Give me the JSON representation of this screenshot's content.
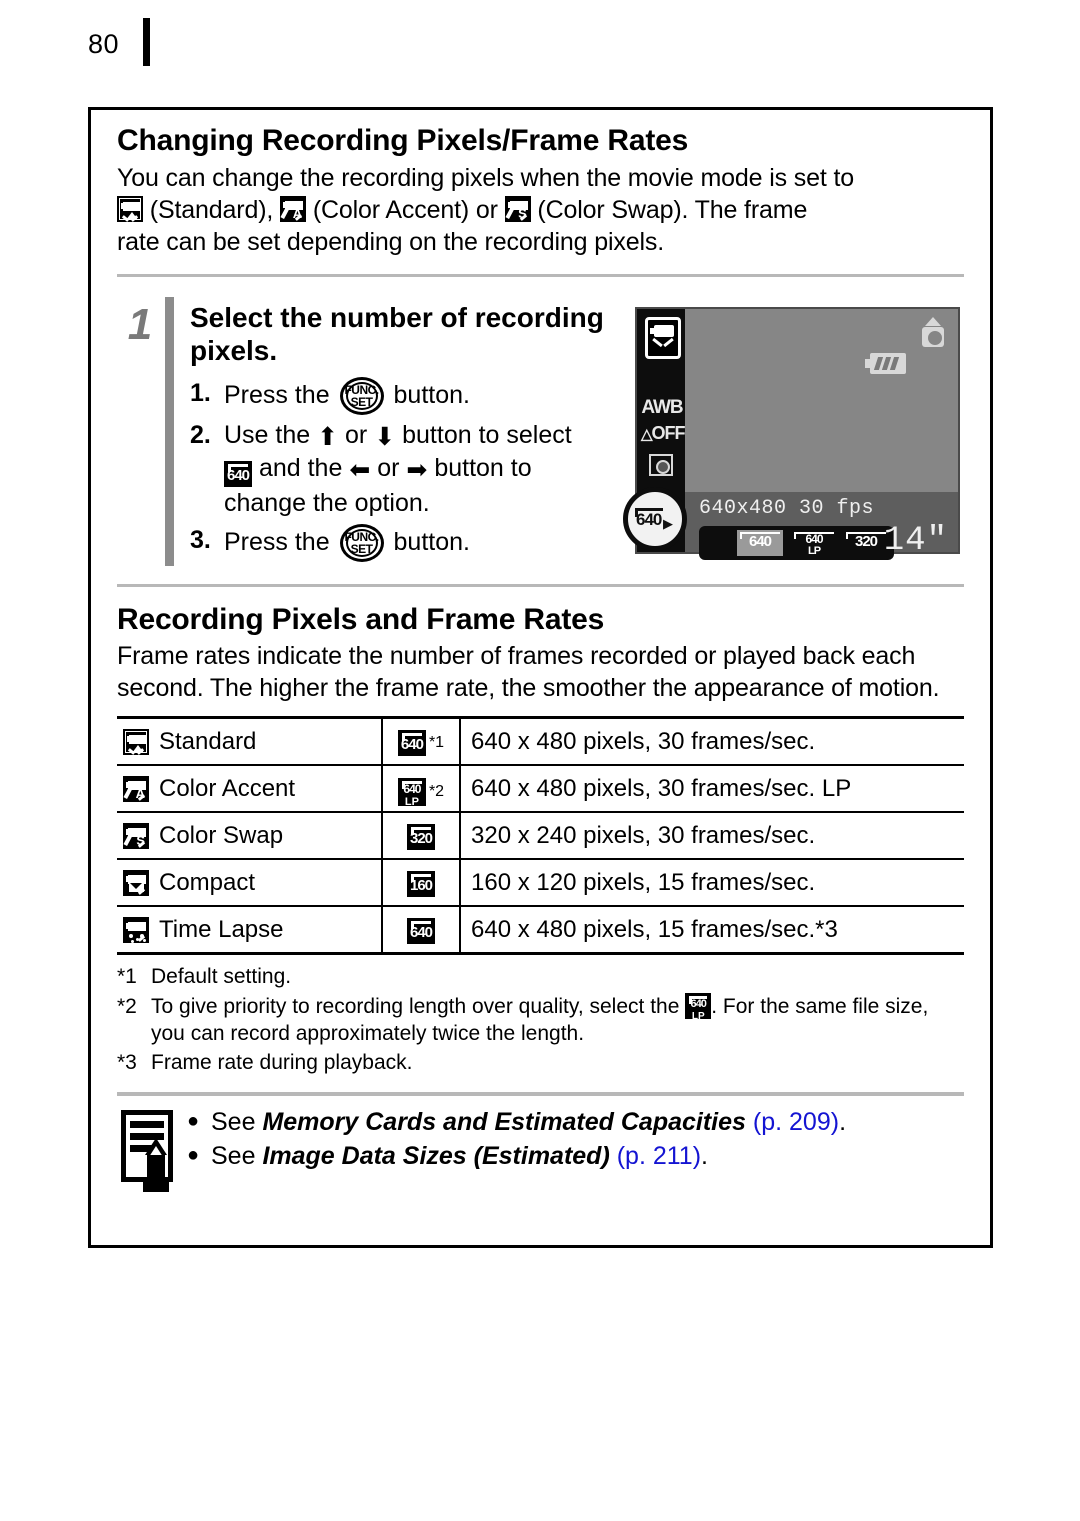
{
  "page": {
    "number": "80"
  },
  "section1": {
    "heading": "Changing Recording Pixels/Frame Rates",
    "intro_a": "You can change the recording pixels when the movie mode is set to",
    "intro_b": "(Standard),",
    "intro_c": "(Color Accent) or",
    "intro_d": "(Color Swap). The frame",
    "intro_e": "rate can be set depending on the recording pixels."
  },
  "step": {
    "number": "1",
    "title": "Select the number of recording pixels.",
    "items": [
      {
        "n": "1.",
        "pre": "Press the",
        "post": "button."
      },
      {
        "n": "2.",
        "pre": "Use the",
        "mid1": "or",
        "mid2": "button to select",
        "mid3": "and the",
        "mid4": "or",
        "mid5": "button to",
        "mid6": "change the option."
      },
      {
        "n": "3.",
        "pre": "Press the",
        "post": "button."
      }
    ],
    "func_label_top": "FUNC.",
    "func_label_bottom": "SET",
    "arrow_up": "⬆",
    "arrow_down": "⬇",
    "arrow_left": "⬅",
    "arrow_right": "➡"
  },
  "lcd": {
    "mode_icon": "movie-mode-icon",
    "white_balance": "AWB",
    "flash": "OFF",
    "metering_icon": "metering-icon",
    "camera_icon": "camera-shake-icon",
    "battery_icon": "battery-icon",
    "resolution_text": "640x480 30 fps",
    "options": [
      {
        "label": "640",
        "selected": true
      },
      {
        "label": "640",
        "sub": "LP",
        "selected": false
      },
      {
        "label": "320",
        "selected": false
      }
    ],
    "duration": "14\"",
    "callout_badge": "640",
    "callout_arrow": "▶"
  },
  "section2": {
    "heading": "Recording Pixels and Frame Rates",
    "paragraph": "Frame rates indicate the number of frames recorded or played back each second. The higher the frame rate, the smoother the appearance of motion."
  },
  "table": {
    "rows": [
      {
        "mode": "Standard",
        "icon": "standard-mode-icon",
        "badge": "640",
        "badge_sub": "",
        "footnote": "*1",
        "spec": "640 x 480 pixels, 30 frames/sec."
      },
      {
        "mode": "Color Accent",
        "icon": "color-accent-mode-icon",
        "badge": "640",
        "badge_sub": "LP",
        "footnote": "*2",
        "spec": "640 x 480 pixels, 30 frames/sec. LP"
      },
      {
        "mode": "Color Swap",
        "icon": "color-swap-mode-icon",
        "badge": "320",
        "badge_sub": "",
        "footnote": "",
        "spec": "320 x 240 pixels, 30 frames/sec."
      },
      {
        "mode": "Compact",
        "icon": "compact-mode-icon",
        "badge": "160",
        "badge_sub": "",
        "footnote": "",
        "spec": "160 x 120 pixels, 15 frames/sec."
      },
      {
        "mode": "Time Lapse",
        "icon": "time-lapse-mode-icon",
        "badge": "640",
        "badge_sub": "",
        "footnote": "",
        "spec": "640 x 480 pixels, 15 frames/sec.*3"
      }
    ]
  },
  "footnotes": [
    {
      "mark": "*1",
      "text": "Default setting."
    },
    {
      "mark": "*2",
      "pre": "To give priority to recording length over quality, select the",
      "post": ". For the same file size, you can record approximately twice the length."
    },
    {
      "mark": "*3",
      "text": "Frame rate during playback."
    }
  ],
  "see_also": {
    "icon": "note-pencil-icon",
    "items": [
      {
        "bullet": "●",
        "prefix": "See ",
        "title": "Memory Cards and Estimated Capacities",
        "page_ref": "(p. 209)",
        "suffix": "."
      },
      {
        "bullet": "●",
        "prefix": "See ",
        "title": "Image Data Sizes (Estimated)",
        "page_ref": "(p. 211)",
        "suffix": "."
      }
    ]
  }
}
